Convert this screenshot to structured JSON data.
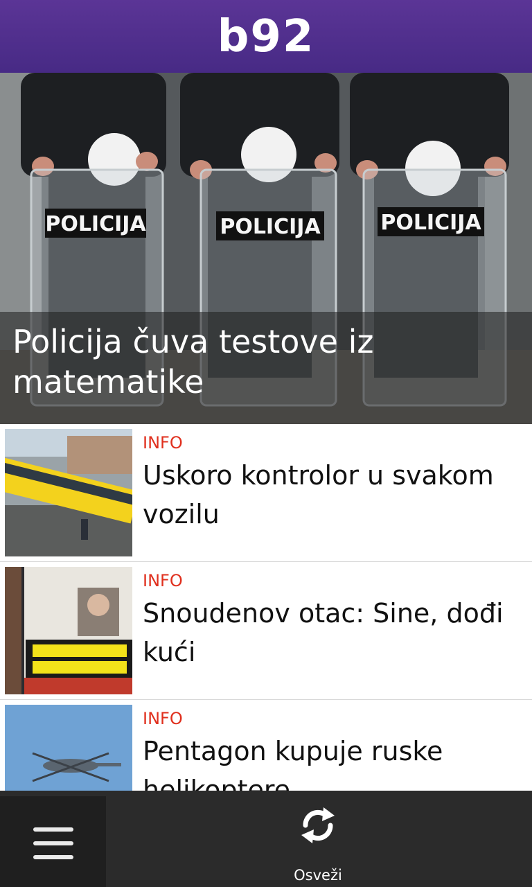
{
  "header": {
    "logo": "b92"
  },
  "hero": {
    "title": "Policija čuva testove iz matematike",
    "shield_text": "POLICIJA"
  },
  "articles": [
    {
      "category": "INFO",
      "title": "Uskoro kontrolor u svakom vozilu"
    },
    {
      "category": "INFO",
      "title": "Snoudenov otac: Sine, dođi kući"
    },
    {
      "category": "INFO",
      "title": "Pentagon kupuje ruske helikoptere"
    }
  ],
  "bottom_bar": {
    "menu_icon": "hamburger-menu-icon",
    "refresh_icon": "refresh-icon",
    "refresh_label": "Osveži"
  },
  "colors": {
    "header": "#4d2d8b",
    "category": "#e0301e",
    "bottom_bar": "#2b2b2b"
  }
}
